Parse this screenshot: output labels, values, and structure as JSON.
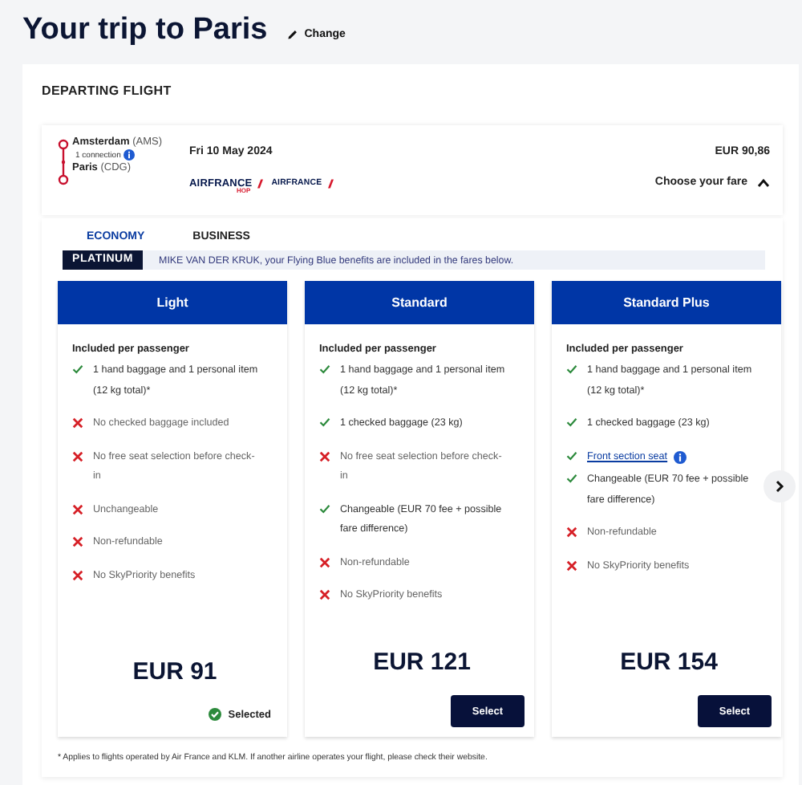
{
  "title": "Your trip to Paris",
  "change_link": "Change",
  "section_title": "DEPARTING FLIGHT",
  "flight": {
    "origin": {
      "city": "Amsterdam",
      "code": "(AMS)"
    },
    "connection": "1 connection",
    "destination": {
      "city": "Paris",
      "code": "(CDG)"
    },
    "date": "Fri 10 May 2024",
    "airlines": [
      {
        "name": "AIRFRANCE",
        "sub": "HOP"
      },
      {
        "name": "AIRFRANCE"
      }
    ],
    "price": "EUR 90,86",
    "choose_label": "Choose your fare",
    "expanded": true
  },
  "cabin_tabs": [
    {
      "label": "ECONOMY",
      "selected": true
    },
    {
      "label": "BUSINESS",
      "selected": false
    }
  ],
  "banner": {
    "badge": "PLATINUM",
    "text": "MIKE VAN DER KRUK, your Flying Blue benefits are included in the fares below."
  },
  "fares": [
    {
      "name": "Light",
      "heading": "Included per passenger",
      "selected": true,
      "price": "EUR 91",
      "action": "Selected",
      "items": [
        {
          "included": true,
          "text": "1 hand baggage and 1 personal item (12 kg total)*"
        },
        {
          "included": false,
          "text": "No checked baggage included"
        },
        {
          "included": false,
          "text": "No free seat selection before check-in"
        },
        {
          "included": false,
          "text": "Unchangeable"
        },
        {
          "included": false,
          "text": "Non-refundable"
        },
        {
          "included": false,
          "text": "No SkyPriority benefits"
        }
      ]
    },
    {
      "name": "Standard",
      "heading": "Included per passenger",
      "selected": false,
      "price": "EUR 121",
      "action": "Select",
      "items": [
        {
          "included": true,
          "text": "1 hand baggage and 1 personal item (12 kg total)*"
        },
        {
          "included": true,
          "text": "1 checked baggage (23 kg)"
        },
        {
          "included": false,
          "text": "No free seat selection before check-in"
        },
        {
          "included": true,
          "text": "Changeable (EUR 70 fee + possible fare difference)"
        },
        {
          "included": false,
          "text": "Non-refundable"
        },
        {
          "included": false,
          "text": "No SkyPriority benefits"
        }
      ]
    },
    {
      "name": "Standard Plus",
      "heading": "Included per passenger",
      "selected": false,
      "price": "EUR 154",
      "action": "Select",
      "items": [
        {
          "included": true,
          "text": "1 hand baggage and 1 personal item (12 kg total)*"
        },
        {
          "included": true,
          "text": "1 checked baggage (23 kg)"
        },
        {
          "included": true,
          "text": "Front section seat",
          "link": true
        },
        {
          "included": true,
          "text": "Changeable (EUR 70 fee + possible fare difference)"
        },
        {
          "included": false,
          "text": "Non-refundable"
        },
        {
          "included": false,
          "text": "No SkyPriority benefits"
        }
      ]
    }
  ],
  "footnote": "* Applies to flights operated by Air France and KLM. If another airline operates your flight, please check their website."
}
